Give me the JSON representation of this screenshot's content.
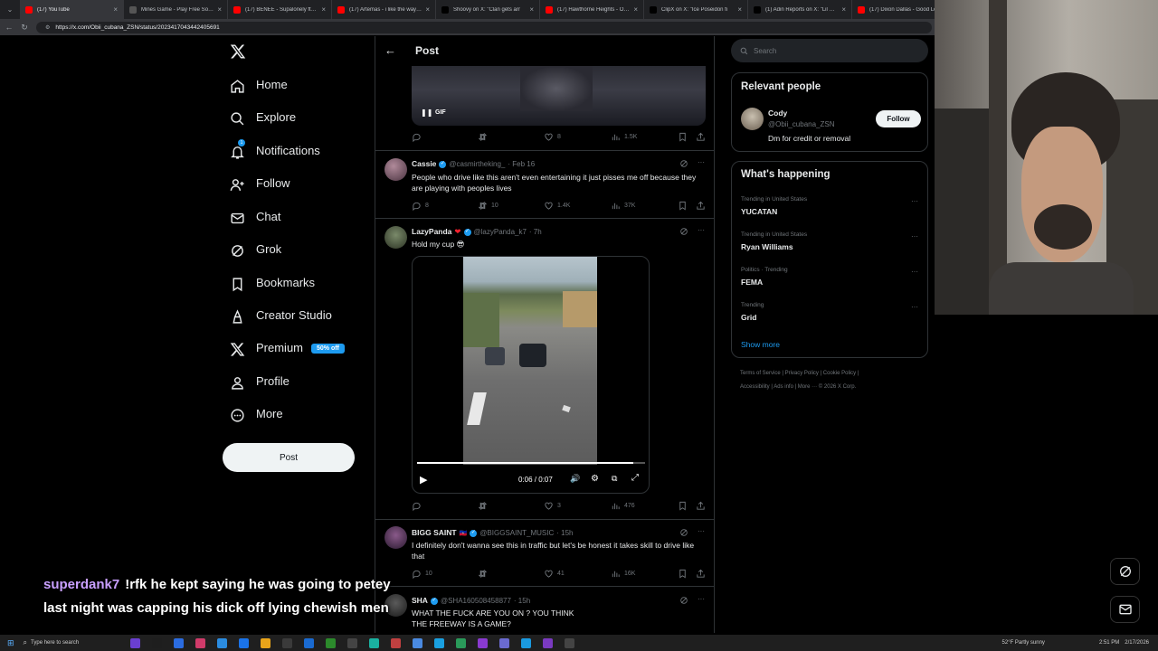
{
  "browser": {
    "tabs": [
      {
        "title": "(17) YouTube",
        "color": "#ff0000"
      },
      {
        "title": "Mines Game - Play Free Social C",
        "color": "#555555"
      },
      {
        "title": "(17) BENEE - Supalonely ft. Gus",
        "color": "#ff0000"
      },
      {
        "title": "(17) Artemas - i like the way you",
        "color": "#ff0000"
      },
      {
        "title": "Shoovy on X: \"Clan gets arr",
        "color": "#000000"
      },
      {
        "title": "(17) Hawthorne Heights - Ohio is",
        "color": "#ff0000"
      },
      {
        "title": "ClipX on X: \"Ice Poseidon fi",
        "color": "#000000"
      },
      {
        "title": "(1) Adin Reports on X: \"Lil Baby",
        "color": "#000000"
      },
      {
        "title": "(17) Dixon Dallas - Good Lo",
        "color": "#ff0000"
      }
    ],
    "url": "https://x.com/Obii_cubana_ZSN/status/2023417043442405691"
  },
  "nav": {
    "items": [
      {
        "label": "Home",
        "icon": "home-icon"
      },
      {
        "label": "Explore",
        "icon": "search-icon"
      },
      {
        "label": "Notifications",
        "icon": "bell-icon"
      },
      {
        "label": "Follow",
        "icon": "follow-icon"
      },
      {
        "label": "Chat",
        "icon": "mail-icon"
      },
      {
        "label": "Grok",
        "icon": "grok-icon"
      },
      {
        "label": "Bookmarks",
        "icon": "bookmark-icon"
      },
      {
        "label": "Creator Studio",
        "icon": "creator-icon"
      },
      {
        "label": "Premium",
        "icon": "x-icon"
      },
      {
        "label": "Profile",
        "icon": "profile-icon"
      },
      {
        "label": "More",
        "icon": "more-icon"
      }
    ],
    "notif_count": "1",
    "premium_badge": "50% off",
    "post_button": "Post"
  },
  "header": {
    "title": "Post"
  },
  "gif_post": {
    "badge": "GIF",
    "replies": "",
    "retweets": "",
    "likes": "8",
    "views": "1.5K"
  },
  "tweets": [
    {
      "name": "Cassie",
      "handle": "@casmirtheking_",
      "time": "· Feb 16",
      "text": "People who drive like this aren't even entertaining it just pisses me off because they are playing with peoples lives",
      "replies": "8",
      "retweets": "10",
      "likes": "1.4K",
      "views": "37K"
    },
    {
      "name": "LazyPanda",
      "handle": "@lazyPanda_k7",
      "time": "· 7h",
      "text": "Hold my cup 😎",
      "replies": "",
      "retweets": "",
      "likes": "3",
      "views": "476",
      "video_time": "0:06 / 0:07",
      "progress": 0.95
    },
    {
      "name": "BIGG SAINT",
      "handle": "@BIGGSAINT_MUSIC",
      "time": "· 15h",
      "text": "I definitely don't wanna see this in traffic but let's be honest it takes skill to drive like that",
      "replies": "10",
      "retweets": "",
      "likes": "41",
      "views": "16K"
    },
    {
      "name": "SHA",
      "handle": "@SHA160508458877",
      "time": "· 15h",
      "text": "WHAT THE FUCK ARE YOU ON ? YOU THINK THE FREEWAY IS A GAME?",
      "replies": "",
      "retweets": "",
      "likes": "",
      "views": ""
    }
  ],
  "search": {
    "placeholder": "Search"
  },
  "relevant": {
    "title": "Relevant people",
    "name": "Cody",
    "handle": "@Obii_cubana_ZSN",
    "bio": "Dm for credit or removal",
    "follow": "Follow"
  },
  "happening": {
    "title": "What's happening",
    "items": [
      {
        "context": "Trending in United States",
        "name": "YUCATAN"
      },
      {
        "context": "Trending in United States",
        "name": "Ryan Williams"
      },
      {
        "context": "Politics · Trending",
        "name": "FEMA"
      },
      {
        "context": "Trending",
        "name": "Grid"
      }
    ],
    "show_more": "Show more"
  },
  "footer": {
    "line1": "Terms of Service  |  Privacy Policy  |  Cookie Policy  |",
    "line2": "Accessibility  |  Ads info  |  More ···  © 2026 X Corp."
  },
  "chat": {
    "username": "superdank7",
    "message": "!rfk he kept saying he was going to petey last night was capping his dick off lying chewish men"
  },
  "taskbar": {
    "search": "Type here to search",
    "weather": "52°F  Partly sunny",
    "time": "2:51 PM",
    "date": "2/17/2026"
  }
}
